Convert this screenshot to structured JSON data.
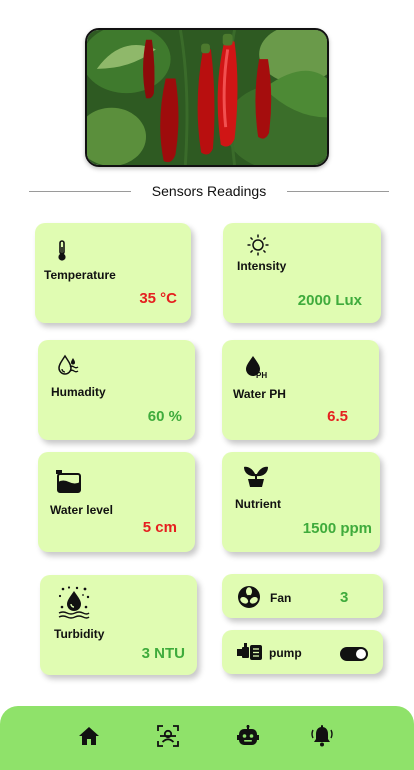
{
  "hero": {
    "image_alt": "red chili peppers on the plant"
  },
  "section": {
    "title": "Sensors Readings"
  },
  "sensors": {
    "temperature": {
      "label": "Temperature",
      "value": "35 °C",
      "icon": "thermometer-icon",
      "value_color": "#e51f1f"
    },
    "intensity": {
      "label": "Intensity",
      "value": "2000 Lux",
      "icon": "sun-icon",
      "value_color": "#3fab3c"
    },
    "humidity": {
      "label": "Humadity",
      "value": "60 %",
      "icon": "humidity-icon",
      "value_color": "#3fab3c"
    },
    "water_ph": {
      "label": "Water PH",
      "value": "6.5",
      "icon": "ph-drop-icon",
      "value_color": "#e51f1f"
    },
    "water_level": {
      "label": "Water level",
      "value": "5 cm",
      "icon": "water-tank-icon",
      "value_color": "#e51f1f"
    },
    "nutrient": {
      "label": "Nutrient",
      "value": "1500 ppm",
      "icon": "sprout-icon",
      "value_color": "#3fab3c"
    },
    "turbidity": {
      "label": "Turbidity",
      "value": "3 NTU",
      "icon": "turbidity-icon",
      "value_color": "#3fab3c"
    }
  },
  "controls": {
    "fan": {
      "label": "Fan",
      "value": "3",
      "icon": "fan-icon"
    },
    "pump": {
      "label": "pump",
      "icon": "pump-icon",
      "toggle_on": true
    }
  },
  "nav": {
    "items": [
      {
        "name": "home",
        "icon": "home-icon"
      },
      {
        "name": "scan",
        "icon": "face-scan-icon"
      },
      {
        "name": "bot",
        "icon": "robot-icon"
      },
      {
        "name": "alerts",
        "icon": "bell-icon"
      }
    ],
    "background": "#8fe26a"
  },
  "colors": {
    "card_bg": "#e0fcb2",
    "value_red": "#e51f1f",
    "value_green": "#3fab3c"
  }
}
